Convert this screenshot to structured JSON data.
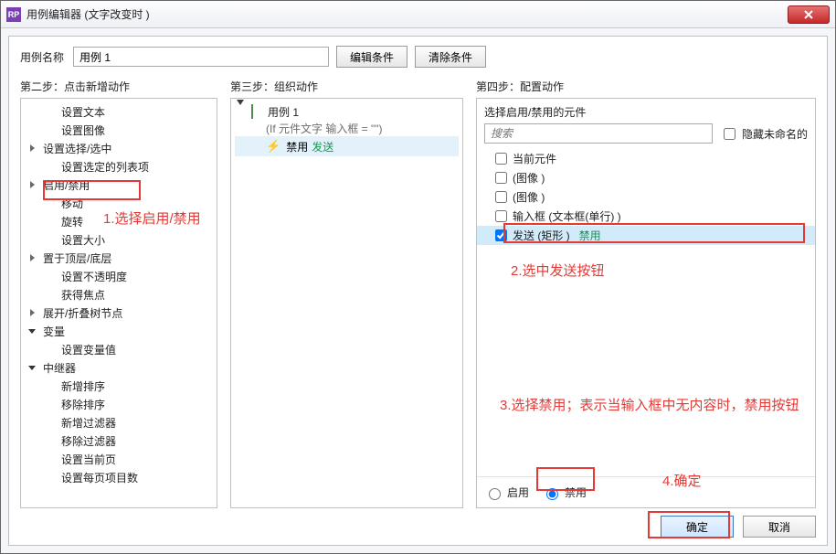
{
  "window": {
    "title": "用例编辑器 (文字改变时  )",
    "app_icon_label": "RP"
  },
  "name_row": {
    "label": "用例名称",
    "value": "用例 1",
    "edit_btn": "编辑条件",
    "clear_btn": "清除条件"
  },
  "columns": {
    "col1_title": "第二步：点击新增动作",
    "col2_title": "第三步：组织动作",
    "col3_title": "第四步：配置动作"
  },
  "action_tree": [
    {
      "type": "child",
      "label": "设置文本"
    },
    {
      "type": "child",
      "label": "设置图像"
    },
    {
      "type": "parent",
      "label": "设置选择/选中"
    },
    {
      "type": "child",
      "label": "设置选定的列表项"
    },
    {
      "type": "parent",
      "label": "启用/禁用",
      "highlight": true
    },
    {
      "type": "child",
      "label": "移动"
    },
    {
      "type": "child",
      "label": "旋转"
    },
    {
      "type": "child",
      "label": "设置大小"
    },
    {
      "type": "parent",
      "label": "置于顶层/底层"
    },
    {
      "type": "child",
      "label": "设置不透明度"
    },
    {
      "type": "child",
      "label": "获得焦点"
    },
    {
      "type": "parent",
      "label": "展开/折叠树节点"
    },
    {
      "type": "parent",
      "label": "变量",
      "expanded": true
    },
    {
      "type": "child",
      "label": "设置变量值"
    },
    {
      "type": "parent",
      "label": "中继器",
      "expanded": true
    },
    {
      "type": "child",
      "label": "新增排序"
    },
    {
      "type": "child",
      "label": "移除排序"
    },
    {
      "type": "child",
      "label": "新增过滤器"
    },
    {
      "type": "child",
      "label": "移除过滤器"
    },
    {
      "type": "child",
      "label": "设置当前页"
    },
    {
      "type": "child",
      "label": "设置每页项目数"
    }
  ],
  "case": {
    "name": "用例 1",
    "condition": "(If 元件文字  输入框 = \"\")",
    "action_label": "禁用",
    "action_target": "发送"
  },
  "right": {
    "header": "选择启用/禁用的元件",
    "search_placeholder": "搜索",
    "hide_unnamed_label": "隐藏未命名的",
    "widgets": [
      {
        "checked": false,
        "name": "当前元件"
      },
      {
        "checked": false,
        "name": "(图像 )"
      },
      {
        "checked": false,
        "name": "(图像 )"
      },
      {
        "checked": false,
        "name": "输入框 (文本框(单行) )"
      },
      {
        "checked": true,
        "name": "发送 (矩形 )",
        "state": "禁用",
        "selected": true
      }
    ],
    "radio_enable": "启用",
    "radio_disable": "禁用"
  },
  "footer": {
    "ok": "确定",
    "cancel": "取消"
  },
  "callouts": {
    "ann1": "1.选择启用/禁用",
    "ann2": "2.选中发送按钮",
    "ann3": "3.选择禁用；表示当输入框中无内容时，禁用按钮",
    "ann4": "4.确定"
  }
}
